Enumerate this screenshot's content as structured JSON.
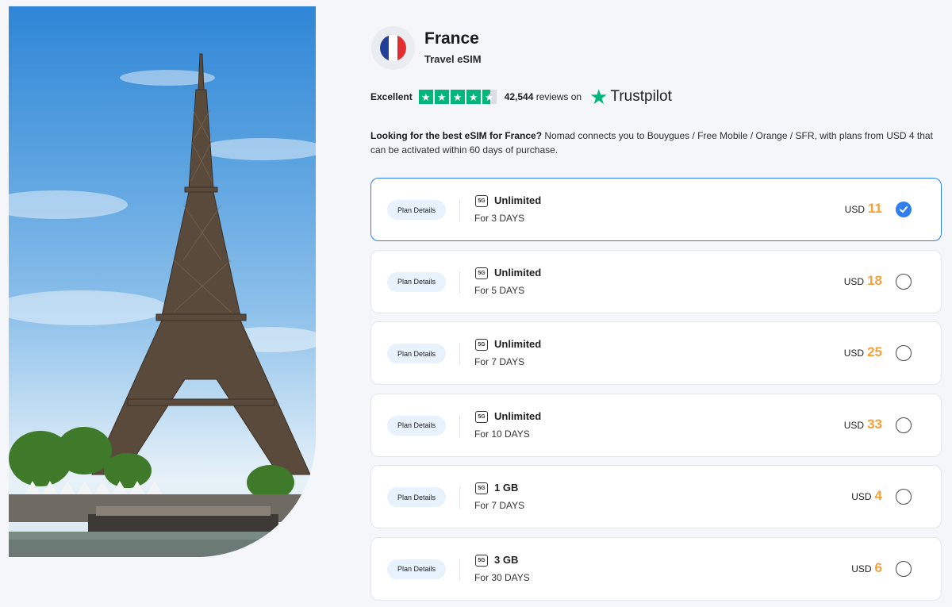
{
  "header": {
    "country": "France",
    "subtitle": "Travel eSIM",
    "flag_colors": [
      "#1f3f99",
      "#ffffff",
      "#e12d2d"
    ]
  },
  "trustpilot": {
    "rating_label": "Excellent",
    "stars": 4.5,
    "review_count": "42,544",
    "reviews_suffix": "reviews on",
    "brand": "Trustpilot",
    "brand_color": "#00b67a"
  },
  "description": {
    "lead": "Looking for the best eSIM for France?",
    "body": " Nomad connects you to Bouygues / Free Mobile / Orange / SFR, with plans from USD 4 that can be activated within 60 days of purchase."
  },
  "plans": [
    {
      "details_label": "Plan Details",
      "network": "5G",
      "data": "Unlimited",
      "duration": "For 3 DAYS",
      "currency": "USD",
      "price": "11",
      "selected": true
    },
    {
      "details_label": "Plan Details",
      "network": "5G",
      "data": "Unlimited",
      "duration": "For 5 DAYS",
      "currency": "USD",
      "price": "18",
      "selected": false
    },
    {
      "details_label": "Plan Details",
      "network": "5G",
      "data": "Unlimited",
      "duration": "For 7 DAYS",
      "currency": "USD",
      "price": "25",
      "selected": false
    },
    {
      "details_label": "Plan Details",
      "network": "5G",
      "data": "Unlimited",
      "duration": "For 10 DAYS",
      "currency": "USD",
      "price": "33",
      "selected": false
    },
    {
      "details_label": "Plan Details",
      "network": "5G",
      "data": "1 GB",
      "duration": "For 7 DAYS",
      "currency": "USD",
      "price": "4",
      "selected": false
    },
    {
      "details_label": "Plan Details",
      "network": "5G",
      "data": "3 GB",
      "duration": "For 30 DAYS",
      "currency": "USD",
      "price": "6",
      "selected": false
    }
  ],
  "colors": {
    "accent": "#2f80ed",
    "price": "#f5a13a",
    "chip_bg": "#e7f2fc"
  }
}
